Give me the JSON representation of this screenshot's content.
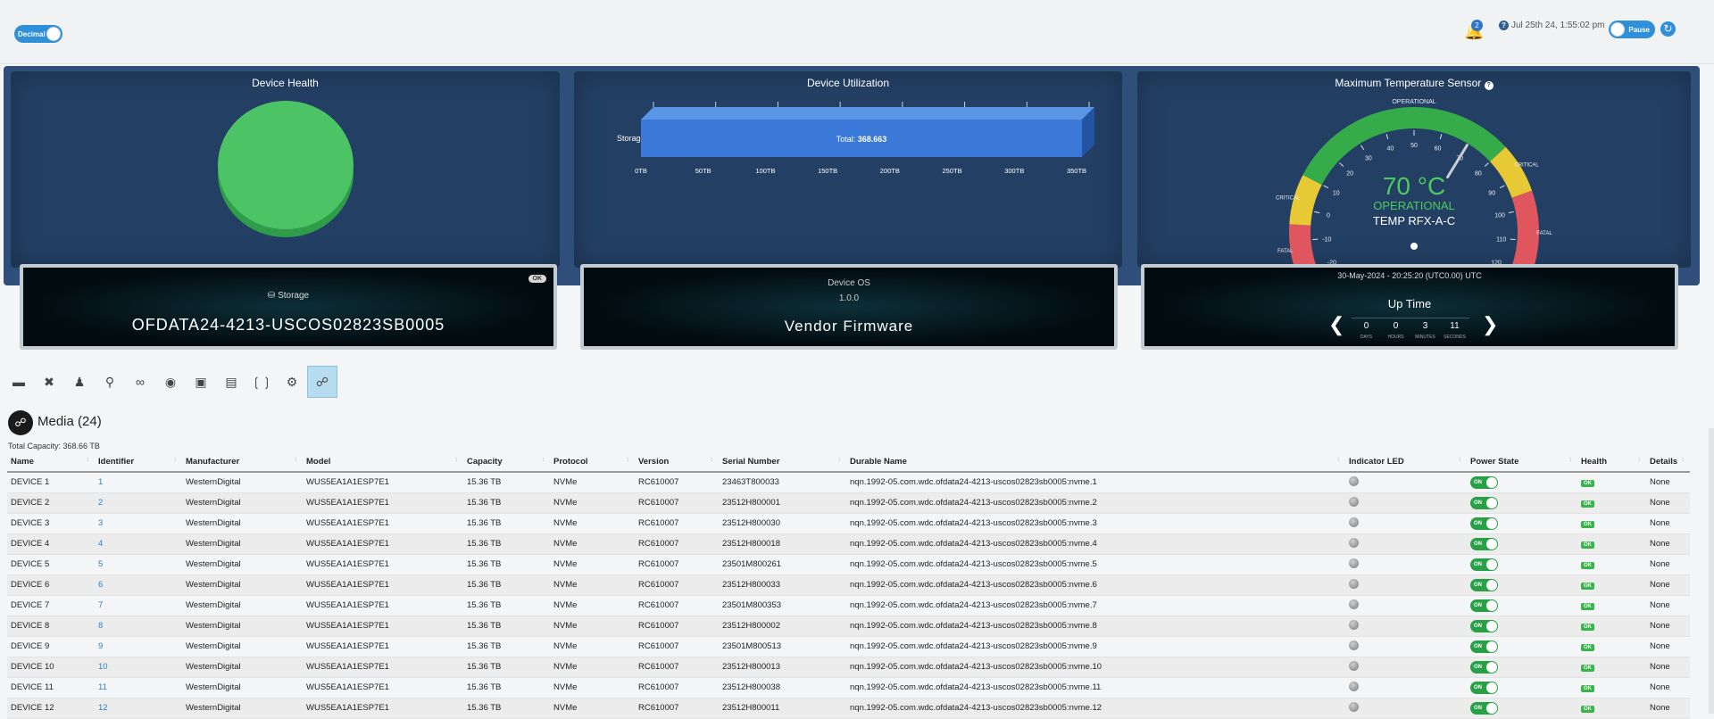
{
  "topbar": {
    "decimal_label": "Decimal",
    "notifications_count": "2",
    "help_glyph": "?",
    "datetime": "Jul 25th 24, 1:55:02 pm",
    "pause_label": "Pause",
    "refresh_glyph": "↻"
  },
  "panels": {
    "health_title": "Device Health",
    "health_color": "#4cc466",
    "utilization_title": "Device Utilization",
    "temperature_title": "Maximum Temperature Sensor"
  },
  "utilization": {
    "category": "Storage",
    "total_label": "Total: ",
    "total_value": "368.663",
    "value_tb": 368.663,
    "xmax_tb": 350,
    "ticks": [
      "0TB",
      "50TB",
      "100TB",
      "150TB",
      "200TB",
      "250TB",
      "300TB",
      "350TB"
    ]
  },
  "gauge": {
    "value": 70,
    "min": -20,
    "max": 120,
    "value_label": "70 °C",
    "status": "OPERATIONAL",
    "sensor": "TEMP RFX-A-C",
    "arc_label_top": "OPERATIONAL",
    "arc_label_critical": "CRITICAL",
    "arc_label_fatal": "FATAL",
    "ticks": [
      "-20",
      "-10",
      "0",
      "10",
      "20",
      "30",
      "40",
      "50",
      "60",
      "70",
      "80",
      "90",
      "100",
      "110",
      "120"
    ]
  },
  "cards": {
    "status_pill": "OK",
    "storage_label": "Storage",
    "storage_name": "OFDATA24-4213-USCOS02823SB0005",
    "os_label": "Device OS",
    "os_version": "1.0.0",
    "firmware": "Vendor Firmware",
    "uptime_date": "30-May-2024 - 20:25:20 (UTC0.00) UTC",
    "uptime_title": "Up Time",
    "uptime": [
      {
        "value": "0",
        "label": "DAYS"
      },
      {
        "value": "0",
        "label": "HOURS"
      },
      {
        "value": "3",
        "label": "MINUTES"
      },
      {
        "value": "11",
        "label": "SECONDS"
      }
    ]
  },
  "toolbar": {
    "icons": [
      "ruler-icon",
      "tools-icon",
      "user-icon",
      "location-pin-icon",
      "network-icon",
      "globe-icon",
      "chip-icon",
      "server-icon",
      "wireless-icon",
      "gear-icon",
      "media-icon"
    ]
  },
  "media": {
    "title": "Media (24)",
    "total_capacity": "Total Capacity: 368.66 TB",
    "columns": [
      "Name",
      "Identifier",
      "Manufacturer",
      "Model",
      "Capacity",
      "Protocol",
      "Version",
      "Serial Number",
      "Durable Name",
      "Indicator LED",
      "Power State",
      "Health",
      "Details"
    ],
    "power_label": "ON",
    "health_label": "OK",
    "rows": [
      {
        "name": "DEVICE 1",
        "id": "1",
        "manufacturer": "WesternDigital",
        "model": "WUS5EA1A1ESP7E1",
        "capacity": "15.36 TB",
        "protocol": "NVMe",
        "version": "RC610007",
        "serial": "23463T800033",
        "durable": "nqn.1992-05.com.wdc.ofdata24-4213-uscos02823sb0005:nvme.1",
        "details": "None"
      },
      {
        "name": "DEVICE 2",
        "id": "2",
        "manufacturer": "WesternDigital",
        "model": "WUS5EA1A1ESP7E1",
        "capacity": "15.36 TB",
        "protocol": "NVMe",
        "version": "RC610007",
        "serial": "23512H800001",
        "durable": "nqn.1992-05.com.wdc.ofdata24-4213-uscos02823sb0005:nvme.2",
        "details": "None"
      },
      {
        "name": "DEVICE 3",
        "id": "3",
        "manufacturer": "WesternDigital",
        "model": "WUS5EA1A1ESP7E1",
        "capacity": "15.36 TB",
        "protocol": "NVMe",
        "version": "RC610007",
        "serial": "23512H800030",
        "durable": "nqn.1992-05.com.wdc.ofdata24-4213-uscos02823sb0005:nvme.3",
        "details": "None"
      },
      {
        "name": "DEVICE 4",
        "id": "4",
        "manufacturer": "WesternDigital",
        "model": "WUS5EA1A1ESP7E1",
        "capacity": "15.36 TB",
        "protocol": "NVMe",
        "version": "RC610007",
        "serial": "23512H800018",
        "durable": "nqn.1992-05.com.wdc.ofdata24-4213-uscos02823sb0005:nvme.4",
        "details": "None"
      },
      {
        "name": "DEVICE 5",
        "id": "5",
        "manufacturer": "WesternDigital",
        "model": "WUS5EA1A1ESP7E1",
        "capacity": "15.36 TB",
        "protocol": "NVMe",
        "version": "RC610007",
        "serial": "23501M800261",
        "durable": "nqn.1992-05.com.wdc.ofdata24-4213-uscos02823sb0005:nvme.5",
        "details": "None"
      },
      {
        "name": "DEVICE 6",
        "id": "6",
        "manufacturer": "WesternDigital",
        "model": "WUS5EA1A1ESP7E1",
        "capacity": "15.36 TB",
        "protocol": "NVMe",
        "version": "RC610007",
        "serial": "23512H800033",
        "durable": "nqn.1992-05.com.wdc.ofdata24-4213-uscos02823sb0005:nvme.6",
        "details": "None"
      },
      {
        "name": "DEVICE 7",
        "id": "7",
        "manufacturer": "WesternDigital",
        "model": "WUS5EA1A1ESP7E1",
        "capacity": "15.36 TB",
        "protocol": "NVMe",
        "version": "RC610007",
        "serial": "23501M800353",
        "durable": "nqn.1992-05.com.wdc.ofdata24-4213-uscos02823sb0005:nvme.7",
        "details": "None"
      },
      {
        "name": "DEVICE 8",
        "id": "8",
        "manufacturer": "WesternDigital",
        "model": "WUS5EA1A1ESP7E1",
        "capacity": "15.36 TB",
        "protocol": "NVMe",
        "version": "RC610007",
        "serial": "23512H800002",
        "durable": "nqn.1992-05.com.wdc.ofdata24-4213-uscos02823sb0005:nvme.8",
        "details": "None"
      },
      {
        "name": "DEVICE 9",
        "id": "9",
        "manufacturer": "WesternDigital",
        "model": "WUS5EA1A1ESP7E1",
        "capacity": "15.36 TB",
        "protocol": "NVMe",
        "version": "RC610007",
        "serial": "23501M800513",
        "durable": "nqn.1992-05.com.wdc.ofdata24-4213-uscos02823sb0005:nvme.9",
        "details": "None"
      },
      {
        "name": "DEVICE 10",
        "id": "10",
        "manufacturer": "WesternDigital",
        "model": "WUS5EA1A1ESP7E1",
        "capacity": "15.36 TB",
        "protocol": "NVMe",
        "version": "RC610007",
        "serial": "23512H800013",
        "durable": "nqn.1992-05.com.wdc.ofdata24-4213-uscos02823sb0005:nvme.10",
        "details": "None"
      },
      {
        "name": "DEVICE 11",
        "id": "11",
        "manufacturer": "WesternDigital",
        "model": "WUS5EA1A1ESP7E1",
        "capacity": "15.36 TB",
        "protocol": "NVMe",
        "version": "RC610007",
        "serial": "23512H800038",
        "durable": "nqn.1992-05.com.wdc.ofdata24-4213-uscos02823sb0005:nvme.11",
        "details": "None"
      },
      {
        "name": "DEVICE 12",
        "id": "12",
        "manufacturer": "WesternDigital",
        "model": "WUS5EA1A1ESP7E1",
        "capacity": "15.36 TB",
        "protocol": "NVMe",
        "version": "RC610007",
        "serial": "23512H800011",
        "durable": "nqn.1992-05.com.wdc.ofdata24-4213-uscos02823sb0005:nvme.12",
        "details": "None"
      }
    ]
  }
}
